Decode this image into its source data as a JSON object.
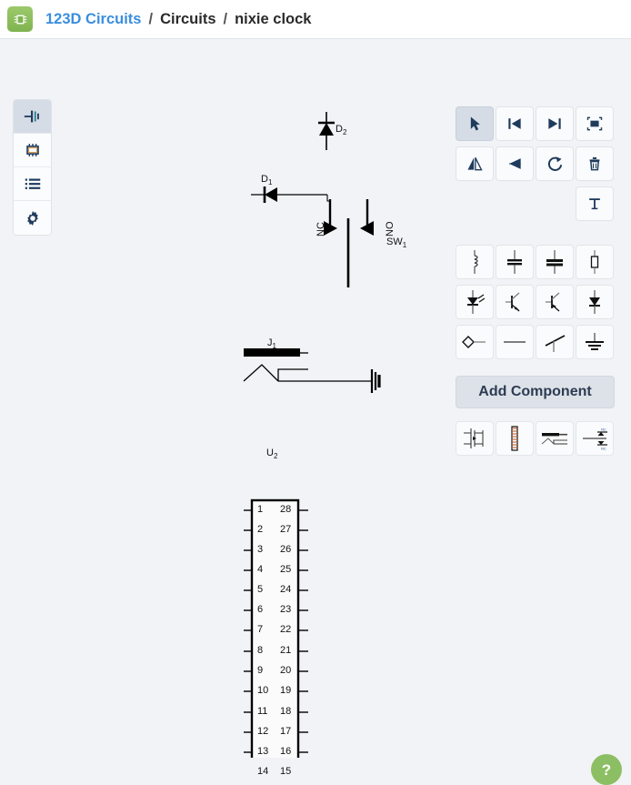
{
  "header": {
    "logo_icon": "chip-icon",
    "breadcrumb": {
      "root": "123D Circuits",
      "sep1": "/",
      "section": "Circuits",
      "sep2": "/",
      "project": "nixie clock"
    }
  },
  "sidebar": {
    "items": [
      {
        "icon": "schematic-icon",
        "name": "schematic",
        "active": true
      },
      {
        "icon": "chip-icon",
        "name": "pcb",
        "active": false
      },
      {
        "icon": "list-icon",
        "name": "components-list",
        "active": false
      },
      {
        "icon": "gear-icon",
        "name": "settings",
        "active": false
      }
    ]
  },
  "toolbar": {
    "row1": [
      {
        "icon": "cursor-icon",
        "label": "Select",
        "active": true
      },
      {
        "icon": "send-to-back-icon",
        "label": "Send to back",
        "active": false
      },
      {
        "icon": "bring-to-front-icon",
        "label": "Bring to front",
        "active": false
      },
      {
        "icon": "select-all-icon",
        "label": "Select all",
        "active": false
      }
    ],
    "row2": [
      {
        "icon": "flip-horizontal-icon",
        "label": "Flip horizontal",
        "active": false
      },
      {
        "icon": "flip-vertical-icon",
        "label": "Flip vertical",
        "active": false
      },
      {
        "icon": "rotate-icon",
        "label": "Rotate",
        "active": false
      },
      {
        "icon": "trash-icon",
        "label": "Delete",
        "active": false
      }
    ],
    "row3": [
      {
        "icon": "text-tool-icon",
        "label": "Text",
        "active": false
      }
    ]
  },
  "palette": {
    "components": [
      {
        "icon": "inductor-icon",
        "label": "Inductor"
      },
      {
        "icon": "capacitor-icon",
        "label": "Capacitor"
      },
      {
        "icon": "polarized-capacitor-icon",
        "label": "Polarized capacitor"
      },
      {
        "icon": "resistor-icon",
        "label": "Resistor"
      },
      {
        "icon": "led-icon",
        "label": "LED"
      },
      {
        "icon": "npn-transistor-icon",
        "label": "NPN transistor"
      },
      {
        "icon": "pnp-transistor-icon",
        "label": "PNP transistor"
      },
      {
        "icon": "diode-icon",
        "label": "Diode"
      },
      {
        "icon": "connector-icon",
        "label": "Connector"
      },
      {
        "icon": "wire-icon",
        "label": "Wire"
      },
      {
        "icon": "switch-icon",
        "label": "Switch"
      },
      {
        "icon": "ground-icon",
        "label": "Ground"
      }
    ],
    "add_component_label": "Add Component",
    "thumbnails": [
      {
        "icon": "mosfet-thumb-icon",
        "label": "MOSFET"
      },
      {
        "icon": "pin-strip-thumb-icon",
        "label": "Pin strip"
      },
      {
        "icon": "jack-thumb-icon",
        "label": "Jack"
      },
      {
        "icon": "switch-nc-no-thumb-icon",
        "label": "NC/NO switch"
      }
    ]
  },
  "schematic": {
    "parts": [
      {
        "ref": "D",
        "sub": "2",
        "type": "diode-vertical"
      },
      {
        "ref": "D",
        "sub": "1",
        "type": "diode-horizontal"
      },
      {
        "ref": "SW",
        "sub": "1",
        "type": "switch",
        "terminal_nc": "NC",
        "terminal_no": "NO"
      },
      {
        "ref": "J",
        "sub": "1",
        "type": "jack"
      },
      {
        "ref": "U",
        "sub": "2",
        "type": "dip-ic",
        "pin_count": 28
      }
    ],
    "ic_pins_left": [
      "1",
      "2",
      "3",
      "4",
      "5",
      "6",
      "7",
      "8",
      "9",
      "10",
      "11",
      "12",
      "13",
      "14"
    ],
    "ic_pins_right": [
      "28",
      "27",
      "26",
      "25",
      "24",
      "23",
      "22",
      "21",
      "20",
      "19",
      "18",
      "17",
      "16",
      "15"
    ]
  },
  "help": {
    "icon": "question-mark-icon",
    "label": "?"
  },
  "colors": {
    "accent_link": "#3b8ede",
    "canvas_bg": "#f2f3f6",
    "active_tool": "#d5dce5",
    "help_green": "#8cbf63",
    "logo_green": "#8cbf63"
  }
}
